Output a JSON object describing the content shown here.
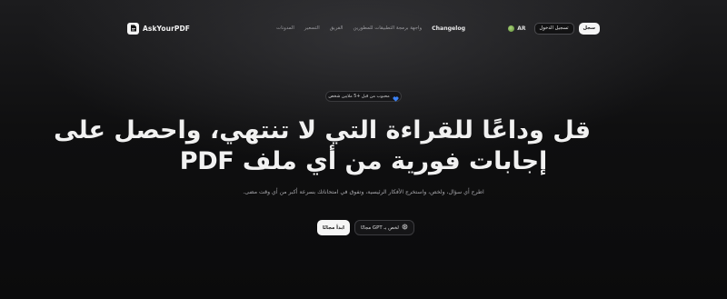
{
  "brand": {
    "name": "AskYourPDF",
    "logo_icon": "pdf-logo-icon"
  },
  "nav": {
    "links": [
      "المدونات",
      "التسعير",
      "الفريق",
      "واجهة برمجة التطبيقات للمطورين",
      "Changelog"
    ]
  },
  "header": {
    "language": "AR",
    "language_icon": "globe-flag-icon",
    "login_label": "تسجيل الدخول",
    "signup_label": "سجل"
  },
  "hero": {
    "badge_icon": "heart-icon",
    "badge_text": "محبوب من قبل +5 ملايين شخص",
    "heading_line1": "قل وداعًا للقراءة التي لا تنتهي، واحصل على",
    "heading_line2": "إجابات فورية من أي ملف PDF",
    "subtext": "اطرح أي سؤال، ولخص، واستخرج الأفكار الرئيسية، وتفوق في امتحاناتك بسرعة أكبر من أي وقت مضى.",
    "cta_primary": "ابدأ مجانًا",
    "cta_secondary": "لخص بـ GPT مجانًا",
    "cta_secondary_icon": "openai-icon"
  },
  "colors": {
    "background": "#0b0b0c",
    "text": "#f1f1f1",
    "muted": "#a6a6aa",
    "heart": "#3b82f6"
  }
}
